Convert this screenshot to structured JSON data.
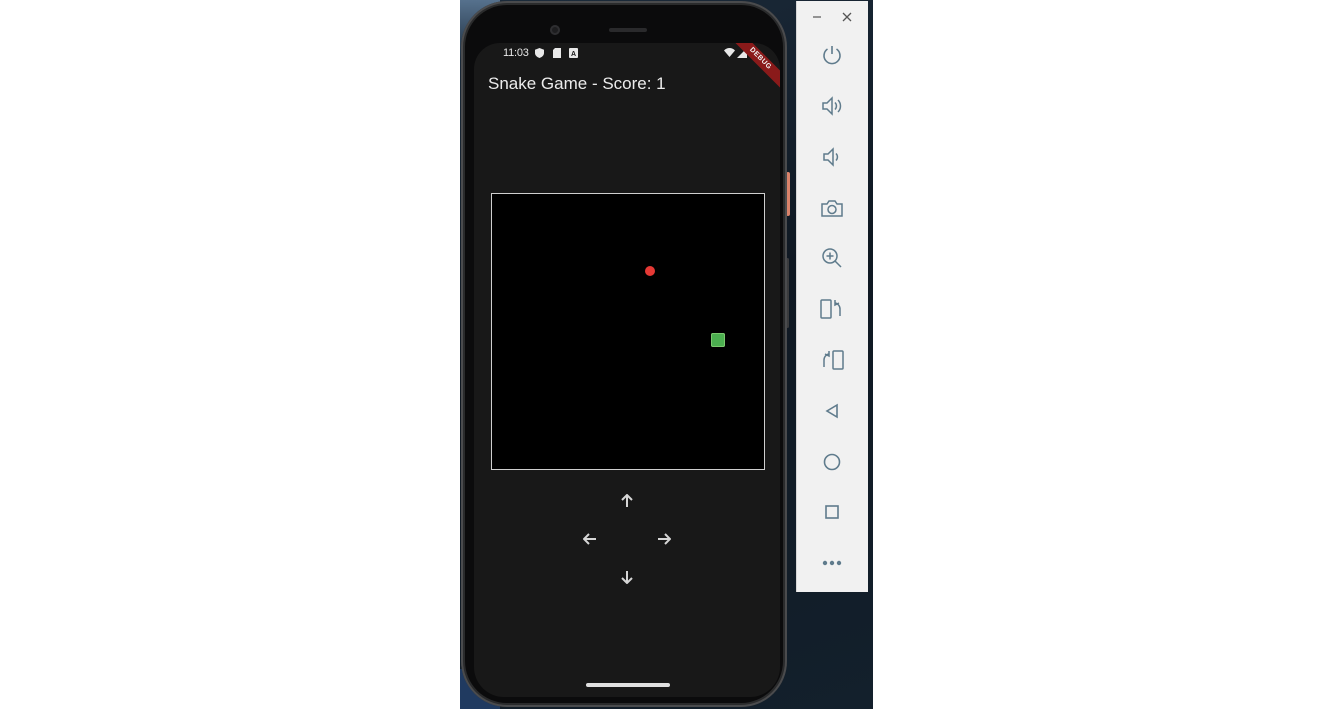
{
  "app": {
    "title": "Snake Game - Score: 1",
    "score": 1
  },
  "statusbar": {
    "time": "11:03",
    "debug_label": "DEBUG",
    "left_icons": [
      "shield-icon",
      "sd-card-icon",
      "notification-a-icon"
    ],
    "right_icons": [
      "wifi-icon",
      "signal-icon",
      "battery-icon"
    ]
  },
  "board": {
    "food_color": "#e53935",
    "snake_color": "#4caf50",
    "border_color": "#cfcfcf"
  },
  "controls": {
    "icons": [
      "arrow-up-icon",
      "arrow-left-icon",
      "arrow-right-icon",
      "arrow-down-icon"
    ]
  },
  "emulator_toolbar": {
    "window_buttons": [
      "minimize-icon",
      "close-icon"
    ],
    "tools": [
      "power-icon",
      "volume-up-icon",
      "volume-down-icon",
      "camera-icon",
      "zoom-in-icon",
      "rotate-left-icon",
      "rotate-right-icon",
      "back-icon",
      "home-icon",
      "overview-icon",
      "more-icon"
    ]
  }
}
